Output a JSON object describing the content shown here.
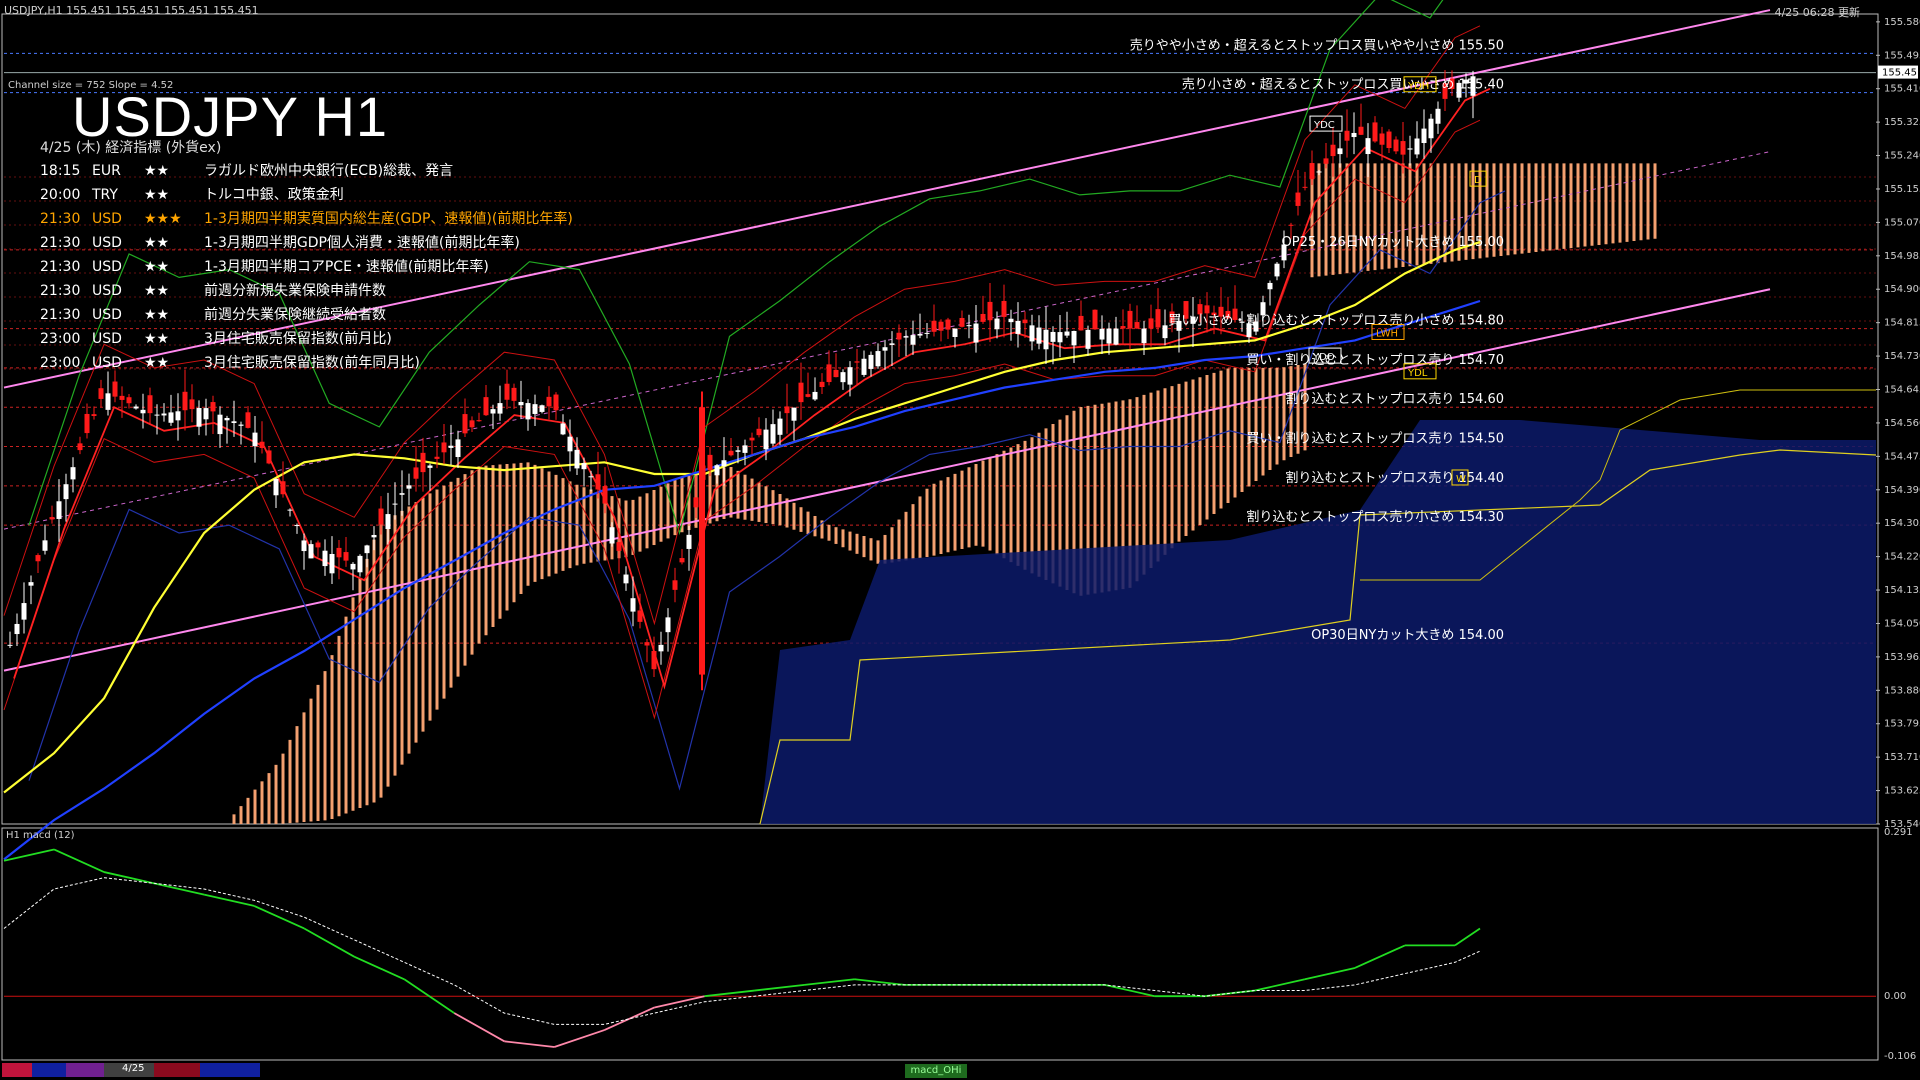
{
  "header": {
    "symbol_info": "USDJPY,H1  155.451 155.451 155.451 155.451",
    "datetime": "4/25 06:28 更新"
  },
  "title": "USDJPY H1",
  "channel_info": "Channel size = 752 Slope = 4.52",
  "calendar": {
    "header": "4/25 (木) 経済指標 (外貨ex)",
    "rows": [
      {
        "time": "18:15",
        "currency": "EUR",
        "stars": "★★",
        "event": "ラガルド欧州中央銀行(ECB)総裁、発言",
        "color": "#ffffff"
      },
      {
        "time": "20:00",
        "currency": "TRY",
        "stars": "★★",
        "event": "トルコ中銀、政策金利",
        "color": "#ffffff"
      },
      {
        "time": "21:30",
        "currency": "USD",
        "stars": "★★★",
        "event": "1-3月期四半期実質国内総生産(GDP、速報値)(前期比年率)",
        "color": "#ffa500"
      },
      {
        "time": "21:30",
        "currency": "USD",
        "stars": "★★",
        "event": "1-3月期四半期GDP個人消費・速報値(前期比年率)",
        "color": "#ffffff"
      },
      {
        "time": "21:30",
        "currency": "USD",
        "stars": "★★",
        "event": "1-3月期四半期コアPCE・速報値(前期比年率)",
        "color": "#ffffff"
      },
      {
        "time": "21:30",
        "currency": "USD",
        "stars": "★★",
        "event": "前週分新規失業保険申請件数",
        "color": "#ffffff"
      },
      {
        "time": "21:30",
        "currency": "USD",
        "stars": "★★",
        "event": "前週分失業保険継続受給者数",
        "color": "#ffffff"
      },
      {
        "time": "23:00",
        "currency": "USD",
        "stars": "★★",
        "event": "3月住宅販売保留指数(前月比)",
        "color": "#ffffff"
      },
      {
        "time": "23:00",
        "currency": "USD",
        "stars": "★★",
        "event": "3月住宅販売保留指数(前年同月比)",
        "color": "#ffffff"
      }
    ]
  },
  "price_axis": {
    "labels": [
      "155.580",
      "155.495",
      "155.410",
      "155.325",
      "155.240",
      "155.155",
      "155.070",
      "154.985",
      "154.900",
      "154.815",
      "154.730",
      "154.645",
      "154.560",
      "154.475",
      "154.390",
      "154.305",
      "154.220",
      "154.135",
      "154.050",
      "153.965",
      "153.880",
      "153.795",
      "153.710",
      "153.625",
      "153.540"
    ],
    "current_price": "155.451"
  },
  "macd_axis": {
    "labels": [
      "0.291",
      "0.00",
      "-0.106"
    ]
  },
  "macd_label": "H1  macd (12)",
  "bottom_tab_label": "4/25",
  "macd_tab_label": "macd_OHi",
  "annotations": [
    {
      "text": "売りやや小さめ・超えるとストップロス買いやや小さめ 155.50",
      "price": 155.5
    },
    {
      "text": "売り小さめ・超えるとストップロス買い小さめ 155.40",
      "price": 155.4
    },
    {
      "text": "OP25・26日NYカット大きめ 155.00",
      "price": 155.0
    },
    {
      "text": "買い小さめ・割り込むとストップロス売り小さめ 154.80",
      "price": 154.8
    },
    {
      "text": "買い・割り込むとストップロス売り 154.70",
      "price": 154.7
    },
    {
      "text": "割り込むとストップロス売り 154.60",
      "price": 154.6
    },
    {
      "text": "買い・割り込むとストップロス売り 154.50",
      "price": 154.5
    },
    {
      "text": "割り込むとストップロス売り 154.40",
      "price": 154.4
    },
    {
      "text": "割り込むとストップロス売り小さめ 154.30",
      "price": 154.3
    },
    {
      "text": "OP30日NYカット大きめ 154.00",
      "price": 154.0
    }
  ],
  "markers": [
    {
      "label": "YDH",
      "price": 155.42,
      "color": "#ffd700"
    },
    {
      "label": "YDC",
      "price": 155.32,
      "color": "#ffffff"
    },
    {
      "label": "LWH",
      "price": 154.79,
      "color": "#ffa500"
    },
    {
      "label": "YDO",
      "price": 154.73,
      "color": "#ffffff"
    },
    {
      "label": "YDL",
      "price": 154.69,
      "color": "#ffd700"
    },
    {
      "label": "D",
      "price": 155.18,
      "color": "#ffd700"
    },
    {
      "label": "W",
      "price": 154.42,
      "color": "#ffd700"
    }
  ],
  "chart_data": {
    "type": "line",
    "title": "USDJPY H1",
    "y_range": [
      153.54,
      155.6
    ],
    "x": [
      0,
      10,
      20,
      30,
      40,
      50,
      60,
      70,
      80,
      90,
      100,
      110,
      120,
      130,
      140,
      150,
      160,
      170,
      180,
      190,
      200,
      210,
      220,
      230,
      240,
      250,
      260,
      270,
      280,
      290,
      295
    ],
    "series": [
      {
        "name": "",
        "values": [
          153.95,
          154.33,
          154.64,
          154.58,
          154.6,
          154.54,
          154.26,
          154.2,
          154.39,
          154.51,
          154.62,
          154.6,
          154.36,
          153.93,
          154.43,
          154.52,
          154.62,
          154.71,
          154.78,
          154.8,
          154.83,
          154.79,
          154.8,
          154.8,
          154.84,
          154.81,
          155.16,
          155.3,
          155.24,
          155.42,
          155.45
        ],
        "color": "#ffffff"
      },
      {
        "name": "",
        "values": [
          153.62,
          153.72,
          153.86,
          154.09,
          154.28,
          154.39,
          154.46,
          154.48,
          154.47,
          154.45,
          154.44,
          154.45,
          154.46,
          154.43,
          154.43,
          154.48,
          154.52,
          154.57,
          154.61,
          154.65,
          154.69,
          154.72,
          154.74,
          154.75,
          154.76,
          154.77,
          154.81,
          154.86,
          154.94,
          155.0,
          155.02
        ],
        "color": "#ffff33"
      },
      {
        "name": "",
        "values": [
          153.45,
          153.55,
          153.63,
          153.72,
          153.82,
          153.91,
          153.98,
          154.06,
          154.14,
          154.21,
          154.28,
          154.34,
          154.39,
          154.4,
          154.44,
          154.48,
          154.52,
          154.55,
          154.59,
          154.62,
          154.65,
          154.67,
          154.69,
          154.7,
          154.72,
          154.73,
          154.75,
          154.77,
          154.81,
          154.85,
          154.87
        ],
        "color": "#2040ff"
      }
    ],
    "channel": {
      "upper": [
        154.65,
        155.61
      ],
      "lower": [
        153.93,
        154.9
      ],
      "mid": [
        154.29,
        155.25
      ]
    },
    "macd": {
      "y_range": [
        -0.106,
        0.291
      ],
      "x": [
        0,
        10,
        20,
        30,
        40,
        50,
        60,
        70,
        80,
        90,
        100,
        110,
        120,
        130,
        140,
        150,
        160,
        170,
        180,
        190,
        200,
        210,
        220,
        230,
        240,
        250,
        260,
        270,
        280,
        290,
        295
      ],
      "main": [
        0.24,
        0.26,
        0.22,
        0.2,
        0.18,
        0.16,
        0.12,
        0.07,
        0.03,
        -0.03,
        -0.08,
        -0.09,
        -0.06,
        -0.02,
        0.0,
        0.01,
        0.02,
        0.03,
        0.02,
        0.02,
        0.02,
        0.02,
        0.02,
        0.0,
        0.0,
        0.01,
        0.03,
        0.05,
        0.09,
        0.09,
        0.12
      ],
      "signal": [
        0.12,
        0.19,
        0.21,
        0.2,
        0.19,
        0.17,
        0.14,
        0.1,
        0.06,
        0.02,
        -0.03,
        -0.05,
        -0.05,
        -0.03,
        -0.01,
        0.0,
        0.01,
        0.02,
        0.02,
        0.02,
        0.02,
        0.02,
        0.02,
        0.01,
        0.0,
        0.01,
        0.01,
        0.02,
        0.04,
        0.06,
        0.08
      ]
    }
  }
}
